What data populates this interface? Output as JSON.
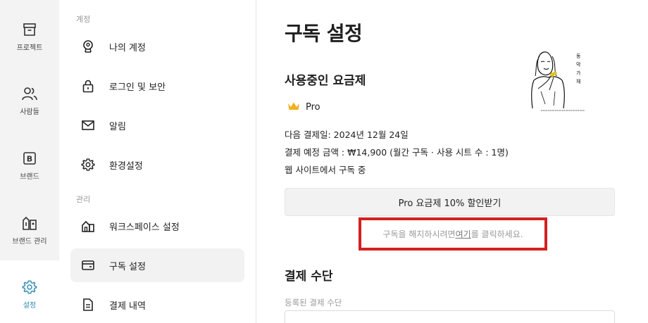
{
  "rail": {
    "items": [
      {
        "label": "프로젝트",
        "icon": "archive-box-icon"
      },
      {
        "label": "사람들",
        "icon": "people-icon"
      },
      {
        "label": "브랜드",
        "icon": "brand-b-icon"
      },
      {
        "label": "브랜드 관리",
        "icon": "brand-manage-icon"
      },
      {
        "label": "설정",
        "icon": "gear-icon",
        "active": true
      }
    ]
  },
  "menu": {
    "section_account": "계정",
    "section_manage": "관리",
    "items": [
      {
        "label": "나의 계정",
        "icon": "user-badge-icon"
      },
      {
        "label": "로그인 및 보안",
        "icon": "lock-icon"
      },
      {
        "label": "알림",
        "icon": "mail-icon"
      },
      {
        "label": "환경설정",
        "icon": "gear-icon"
      },
      {
        "label": "워크스페이스 설정",
        "icon": "building-icon"
      },
      {
        "label": "구독 설정",
        "icon": "wallet-icon",
        "active": true
      },
      {
        "label": "결제 내역",
        "icon": "document-icon"
      }
    ]
  },
  "main": {
    "title": "구독 설정",
    "plan_section": "사용중인 요금제",
    "plan_name": "Pro",
    "next_payment": "다음 결제일: 2024년 12월 24일",
    "expected_amount": "결제 예정 금액 : ₩14,900 (월간 구독 · 사용 시트 수 : 1명)",
    "subscribed_via": "웹 사이트에서 구독 중",
    "discount_button": "Pro 요금제 10% 할인받기",
    "cancel_prefix": "구독을 해지하시려면 ",
    "cancel_link": "여기",
    "cancel_suffix": "를 클릭하세요.",
    "payment_section": "결제 수단",
    "registered_method_label": "등록된 결제 수단"
  },
  "colors": {
    "accent": "#2a8ab0",
    "highlight_border": "#d42020",
    "crown": "#f2b01e"
  }
}
